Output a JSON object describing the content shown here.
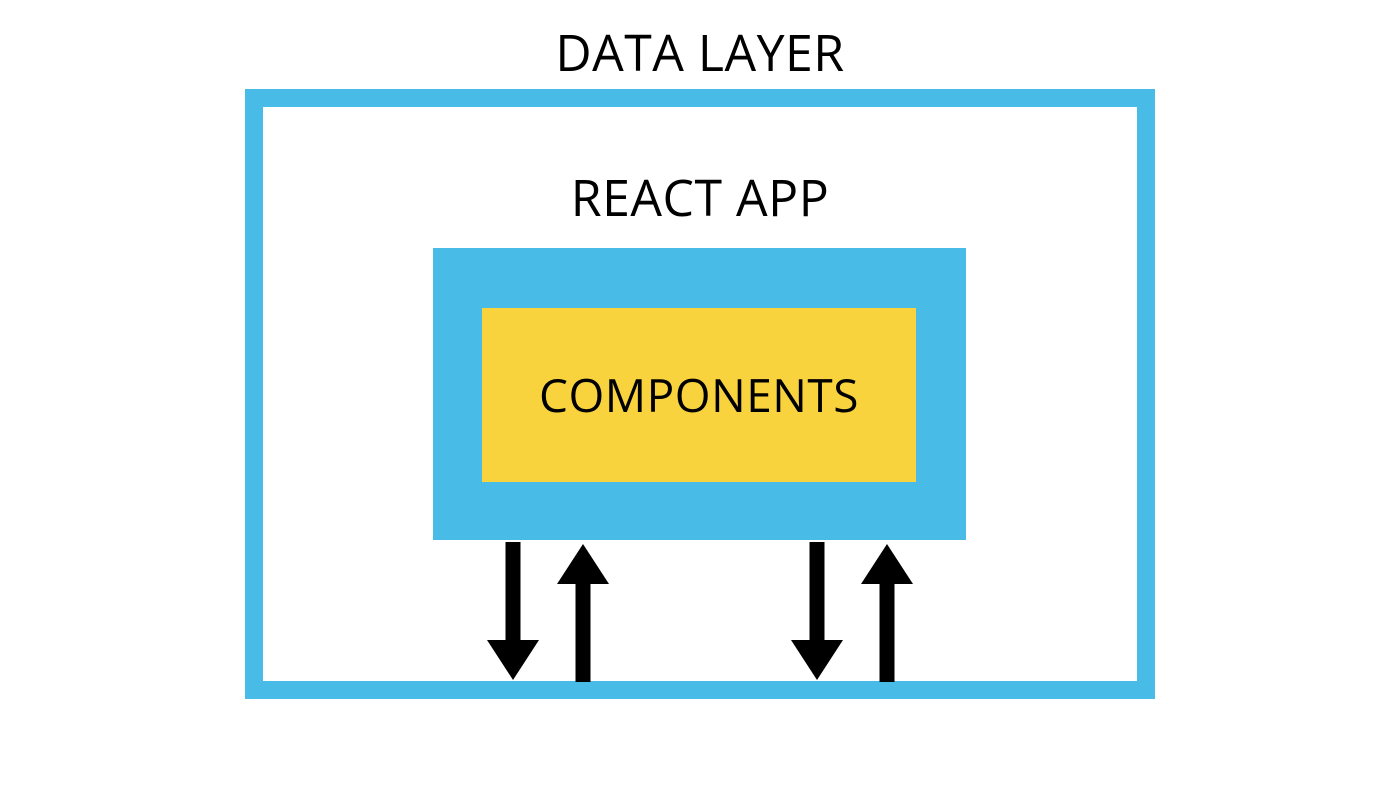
{
  "labels": {
    "outer": "DATA LAYER",
    "middle": "REACT APP",
    "inner": "COMPONENTS"
  },
  "colors": {
    "container_blue": "#48bbe6",
    "highlight_yellow": "#f9d33d",
    "background": "#ffffff",
    "text": "#000000",
    "arrows": "#000000"
  }
}
